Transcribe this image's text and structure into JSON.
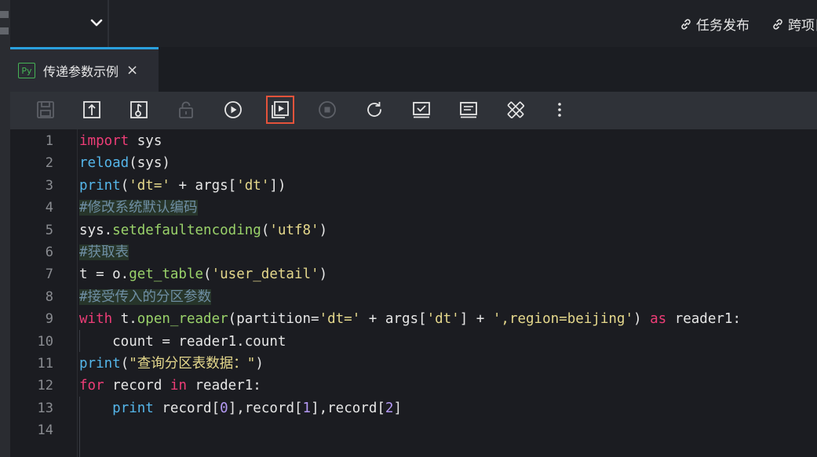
{
  "topbar": {
    "links": [
      {
        "label": "任务发布",
        "icon": "link-icon"
      },
      {
        "label": "跨项目",
        "icon": "link-icon"
      }
    ]
  },
  "tab": {
    "icon_text": "Py",
    "title": "传递参数示例",
    "close": "×"
  },
  "toolbar": {
    "buttons": [
      "save-icon",
      "upload-icon",
      "commit-icon",
      "lock-icon",
      "run-icon",
      "run-with-params-icon",
      "stop-icon",
      "refresh-icon",
      "check-icon",
      "format-icon",
      "settings-icon",
      "more-icon"
    ],
    "highlighted": "run-with-params-icon"
  },
  "editor": {
    "line_numbers": [
      "1",
      "2",
      "3",
      "4",
      "5",
      "6",
      "7",
      "8",
      "9",
      "10",
      "11",
      "12",
      "13",
      "14"
    ],
    "lines": [
      [
        {
          "t": "import",
          "c": "kw"
        },
        {
          "t": " sys",
          "c": ""
        }
      ],
      [
        {
          "t": "reload",
          "c": "fn"
        },
        {
          "t": "(sys)",
          "c": ""
        }
      ],
      [
        {
          "t": "print",
          "c": "fn"
        },
        {
          "t": "(",
          "c": ""
        },
        {
          "t": "'dt='",
          "c": "str"
        },
        {
          "t": " + args[",
          "c": ""
        },
        {
          "t": "'dt'",
          "c": "str"
        },
        {
          "t": "])",
          "c": ""
        }
      ],
      [
        {
          "t": "#修改系统默认编码",
          "c": "cm"
        }
      ],
      [
        {
          "t": "sys.",
          "c": ""
        },
        {
          "t": "setdefaultencoding",
          "c": "fnc"
        },
        {
          "t": "(",
          "c": ""
        },
        {
          "t": "'utf8'",
          "c": "str"
        },
        {
          "t": ")",
          "c": ""
        }
      ],
      [
        {
          "t": "#获取表",
          "c": "cm"
        }
      ],
      [
        {
          "t": "t = o.",
          "c": ""
        },
        {
          "t": "get_table",
          "c": "fnc"
        },
        {
          "t": "(",
          "c": ""
        },
        {
          "t": "'user_detail'",
          "c": "str"
        },
        {
          "t": ")",
          "c": ""
        }
      ],
      [
        {
          "t": "#接受传入的分区参数",
          "c": "cm"
        }
      ],
      [
        {
          "t": "with",
          "c": "kw"
        },
        {
          "t": " t.",
          "c": ""
        },
        {
          "t": "open_reader",
          "c": "fnc"
        },
        {
          "t": "(partition=",
          "c": ""
        },
        {
          "t": "'dt='",
          "c": "str"
        },
        {
          "t": " + args[",
          "c": ""
        },
        {
          "t": "'dt'",
          "c": "str"
        },
        {
          "t": "] + ",
          "c": ""
        },
        {
          "t": "',region=beijing'",
          "c": "str"
        },
        {
          "t": ") ",
          "c": ""
        },
        {
          "t": "as",
          "c": "kw"
        },
        {
          "t": " reader1:",
          "c": ""
        }
      ],
      [
        {
          "t": "    count = reader1.count",
          "c": ""
        }
      ],
      [
        {
          "t": "print",
          "c": "fn"
        },
        {
          "t": "(",
          "c": ""
        },
        {
          "t": "\"查询分区表数据：\"",
          "c": "str"
        },
        {
          "t": ")",
          "c": ""
        }
      ],
      [
        {
          "t": "for",
          "c": "kw"
        },
        {
          "t": " record ",
          "c": ""
        },
        {
          "t": "in",
          "c": "kw"
        },
        {
          "t": " reader1:",
          "c": ""
        }
      ],
      [
        {
          "t": "    ",
          "c": ""
        },
        {
          "t": "print",
          "c": "fn"
        },
        {
          "t": " record[",
          "c": ""
        },
        {
          "t": "0",
          "c": "num"
        },
        {
          "t": "],record[",
          "c": ""
        },
        {
          "t": "1",
          "c": "num"
        },
        {
          "t": "],record[",
          "c": ""
        },
        {
          "t": "2",
          "c": "num"
        },
        {
          "t": "]",
          "c": ""
        }
      ],
      []
    ]
  }
}
